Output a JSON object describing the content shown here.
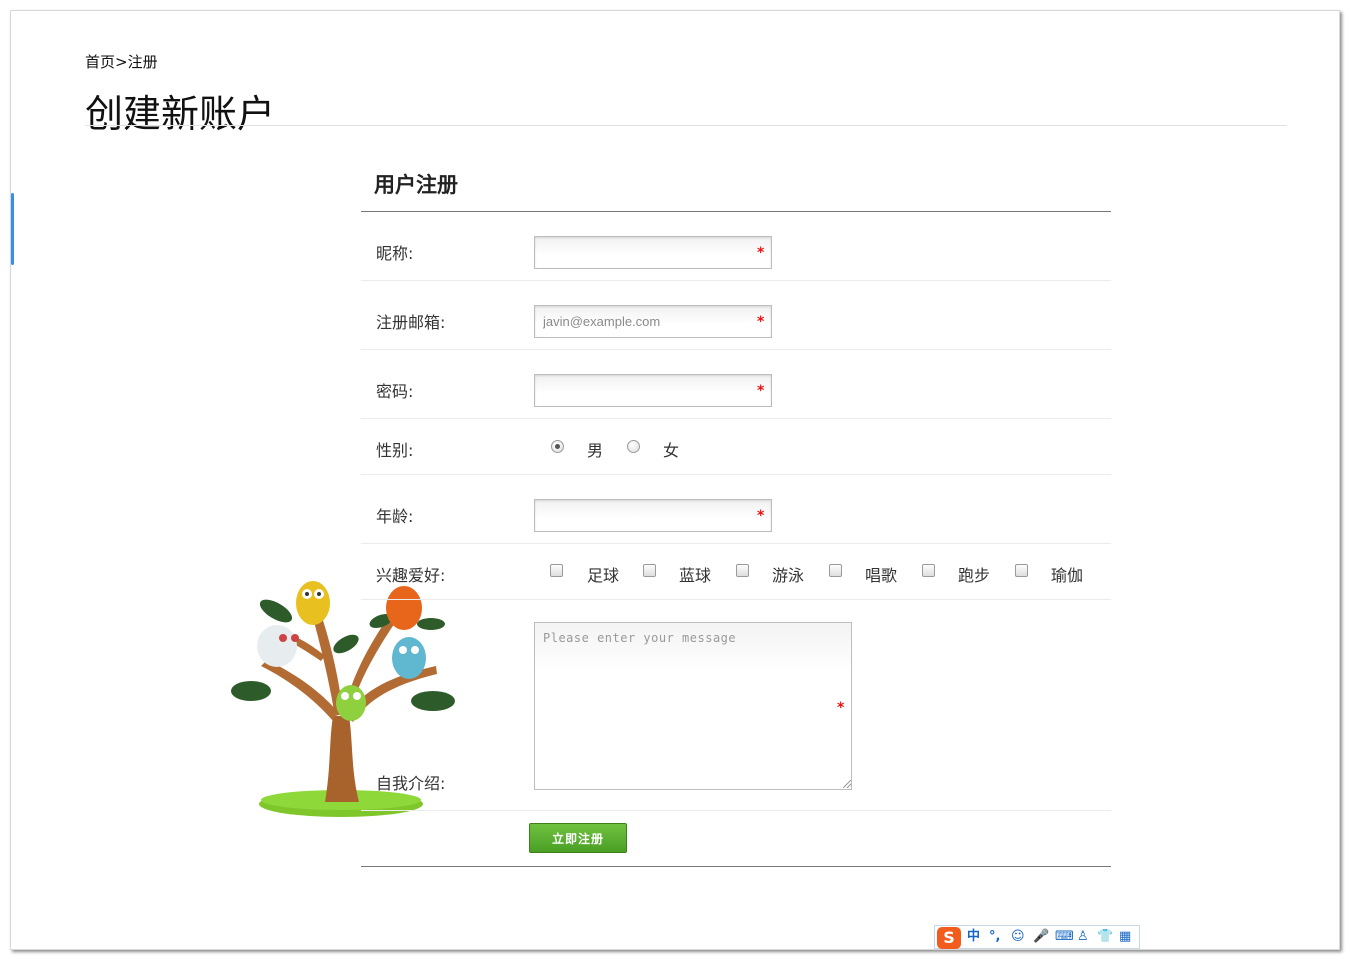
{
  "breadcrumb": {
    "home": "首页",
    "separator": ">",
    "current": "注册"
  },
  "page_title": "创建新账户",
  "form": {
    "heading": "用户注册",
    "fields": {
      "nickname": {
        "label": "昵称:",
        "value": "",
        "placeholder": "",
        "required_mark": "*"
      },
      "email": {
        "label": "注册邮箱:",
        "value": "",
        "placeholder": "javin@example.com",
        "required_mark": "*"
      },
      "password": {
        "label": "密码:",
        "value": "",
        "placeholder": "",
        "required_mark": "*"
      },
      "age": {
        "label": "年龄:",
        "value": "",
        "placeholder": "",
        "required_mark": "*"
      },
      "intro": {
        "label": "自我介绍:",
        "value": "",
        "placeholder": "Please enter your message",
        "required_mark": "*"
      }
    },
    "gender": {
      "label": "性别:",
      "options": [
        {
          "label": "男",
          "checked": true
        },
        {
          "label": "女",
          "checked": false
        }
      ]
    },
    "hobbies": {
      "label": "兴趣爱好:",
      "options": [
        {
          "label": "足球",
          "checked": false
        },
        {
          "label": "蓝球",
          "checked": false
        },
        {
          "label": "游泳",
          "checked": false
        },
        {
          "label": "唱歌",
          "checked": false
        },
        {
          "label": "跑步",
          "checked": false
        },
        {
          "label": "瑜伽",
          "checked": false
        }
      ]
    },
    "submit_label": "立即注册"
  },
  "ime_toolbar": {
    "logo": "S",
    "items": [
      "中",
      "°,",
      "☺",
      "🎤",
      "⌨",
      "♙",
      "👕",
      "▦"
    ]
  },
  "colors": {
    "accent_blue": "#3a8ee6",
    "required_red": "#e11111",
    "button_green": "#5aaf2f",
    "ime_orange": "#f25c1c"
  }
}
